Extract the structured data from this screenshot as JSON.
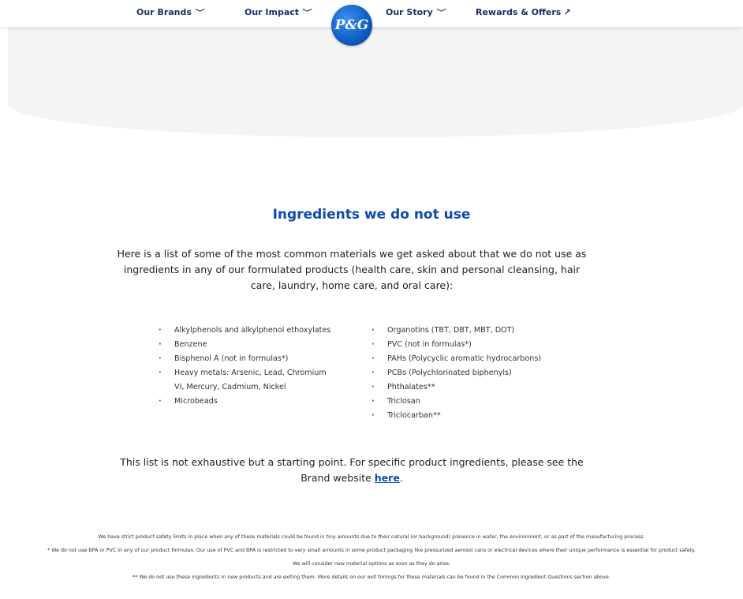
{
  "nav": {
    "brands": "Our Brands",
    "impact": "Our Impact",
    "story": "Our Story",
    "rewards": "Rewards & Offers",
    "chevron": "﹀",
    "arrow": "↗",
    "logo_text": "P&G",
    "logo_color": "#1160c8"
  },
  "main": {
    "title": "Ingredients we do not use",
    "intro": "Here is a list of some of the most common materials we get asked about that we do not use as ingredients in any of our formulated products (health care, skin and personal cleansing, hair care, laundry, home care, and oral care):",
    "left_list": [
      "Alkylphenols and alkylphenol ethoxylates",
      "Benzene",
      "Bisphenol A (not in formulas*)",
      "Heavy metals: Arsenic, Lead, Chromium VI, Mercury, Cadmium, Nickel",
      "Microbeads"
    ],
    "right_list": [
      "Organotins (TBT, DBT, MBT, DOT)",
      "PVC (not in formulas*)",
      "PAHs (Polycyclic aromatic hydrocarbons)",
      "PCBs (Polychlorinated biphenyls)",
      "Phthalates**",
      "Triclosan",
      "Triclocarban**"
    ],
    "note_before": "This list is not exhaustive but a starting point. For specific product ingredients, please see the Brand website ",
    "note_link": "here",
    "note_after": "."
  },
  "footnotes": [
    "We have strict product safety limits in place when any of these materials could be found in tiny amounts due to their natural (or background) presence in water, the environment, or as part of the manufacturing process.",
    "* We do not use BPA or PVC in any of our product formulas. Our use of PVC and BPA is restricted to very small amounts in some product packaging like pressurized aerosol cans or electrical devices where their unique performance is essential for product safety. We will consider new material options as soon as they do arise.",
    "** We do not use these ingredients in new products and are exiting them. More details on our exit timings for these materials can be found in the Common Ingredient Questions section above."
  ]
}
